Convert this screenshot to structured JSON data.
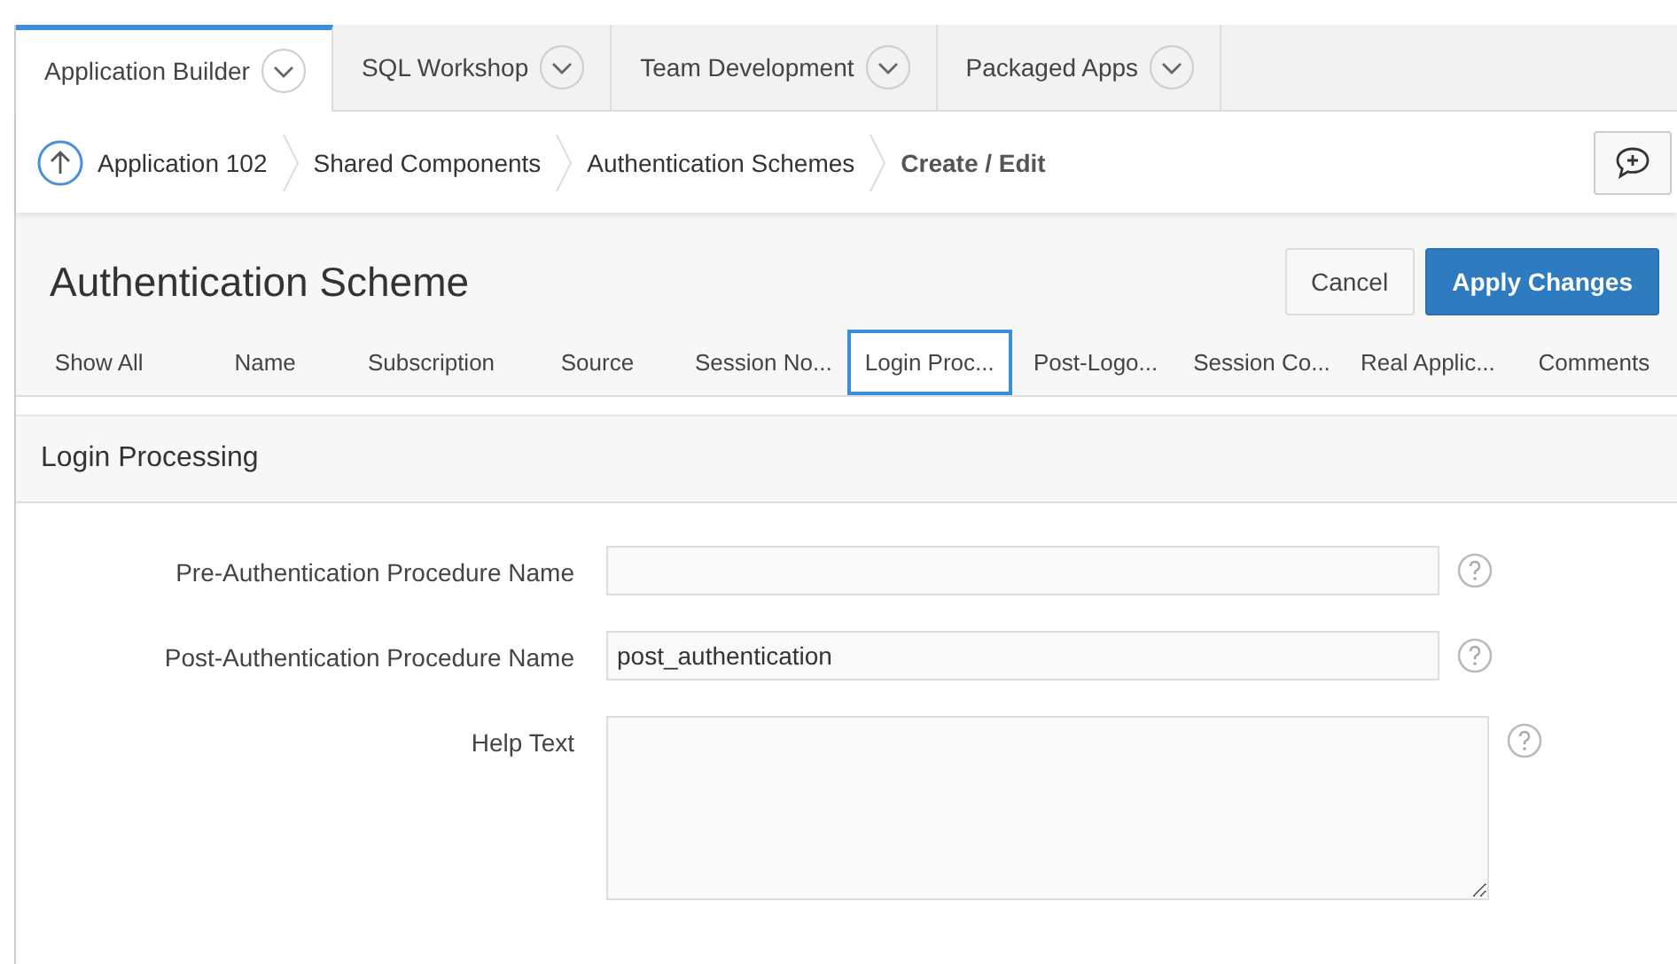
{
  "main_tabs": [
    {
      "label": "Application Builder",
      "selected": true
    },
    {
      "label": "SQL Workshop",
      "selected": false
    },
    {
      "label": "Team Development",
      "selected": false
    },
    {
      "label": "Packaged Apps",
      "selected": false
    }
  ],
  "breadcrumb": [
    "Application 102",
    "Shared Components",
    "Authentication Schemes",
    "Create / Edit"
  ],
  "page_title": "Authentication Scheme",
  "buttons": [
    {
      "label": "Cancel",
      "kind": "secondary"
    },
    {
      "label": "Apply Changes",
      "kind": "primary"
    }
  ],
  "section_tabs": [
    {
      "label": "Show All",
      "selected": false
    },
    {
      "label": "Name",
      "selected": false
    },
    {
      "label": "Subscription",
      "selected": false
    },
    {
      "label": "Source",
      "selected": false
    },
    {
      "label": "Session No...",
      "selected": false
    },
    {
      "label": "Login Proc...",
      "selected": true
    },
    {
      "label": "Post-Logo...",
      "selected": false
    },
    {
      "label": "Session Co...",
      "selected": false
    },
    {
      "label": "Real Applic...",
      "selected": false
    },
    {
      "label": "Comments",
      "selected": false
    }
  ],
  "region_title": "Login Processing",
  "fields": [
    {
      "label": "Pre-Authentication Procedure Name",
      "kind": "text"
    },
    {
      "label": "Post-Authentication Procedure Name",
      "kind": "text",
      "value": "post_authentication"
    },
    {
      "label": "Help Text",
      "kind": "textarea"
    }
  ]
}
